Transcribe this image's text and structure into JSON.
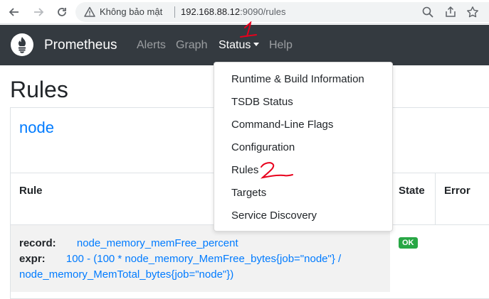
{
  "browser": {
    "security_label": "Không bảo mật",
    "url_host": "192.168.88.12",
    "url_rest": ":9090/rules"
  },
  "navbar": {
    "brand": "Prometheus",
    "links": [
      "Alerts",
      "Graph",
      "Status",
      "Help"
    ]
  },
  "status_menu": {
    "items": [
      "Runtime & Build Information",
      "TSDB Status",
      "Command-Line Flags",
      "Configuration",
      "Rules",
      "Targets",
      "Service Discovery"
    ]
  },
  "page": {
    "title": "Rules",
    "group": {
      "name": "node",
      "columns": [
        "Rule",
        "State",
        "Error"
      ],
      "rules": [
        {
          "record_label": "record:",
          "record": "node_memory_memFree_percent",
          "expr_label": "expr:",
          "expr_line1": "100 - (100 * node_memory_MemFree_bytes{job=\"node\"} /",
          "expr_line2": "node_memory_MemTotal_bytes{job=\"node\"})",
          "state": "OK"
        }
      ]
    }
  },
  "annotations": [
    "1",
    "2"
  ],
  "colors": {
    "navbar_bg": "#343a40",
    "link_blue": "#007bff",
    "ok_green": "#28a745",
    "annotation_red": "#e8001c"
  }
}
